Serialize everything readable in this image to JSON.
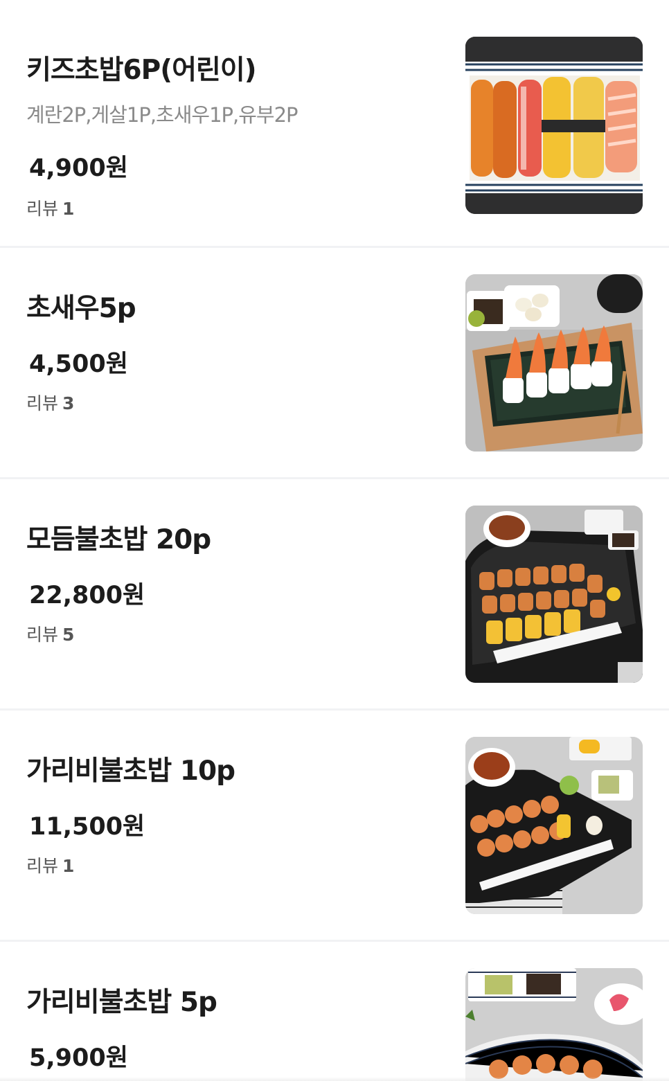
{
  "menu": {
    "items": [
      {
        "name": "키즈초밥6P(어린이)",
        "description": "계란2P,게살1P,초새우1P,유부2P",
        "price": "4,900원",
        "review_label": "리뷰",
        "review_count": "1",
        "image": "kids-sushi-photo"
      },
      {
        "name": "초새우5p",
        "price": "4,500원",
        "review_label": "리뷰",
        "review_count": "3",
        "image": "shrimp-sushi-photo"
      },
      {
        "name": "모듬불초밥 20p",
        "price": "22,800원",
        "review_label": "리뷰",
        "review_count": "5",
        "image": "assorted-seared-sushi-photo"
      },
      {
        "name": "가리비불초밥 10p",
        "price": "11,500원",
        "review_label": "리뷰",
        "review_count": "1",
        "image": "scallop-seared-sushi-10-photo"
      },
      {
        "name": "가리비불초밥 5p",
        "price": "5,900원",
        "image": "scallop-seared-sushi-5-photo"
      }
    ]
  }
}
